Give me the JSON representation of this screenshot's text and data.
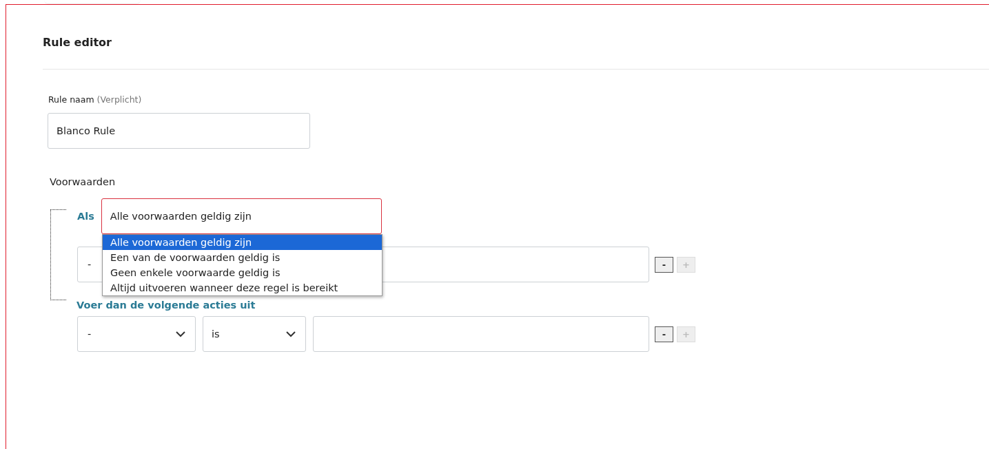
{
  "title": "Rule editor",
  "name_field": {
    "label": "Rule naam",
    "hint": "(Verplicht)",
    "value": "Blanco Rule"
  },
  "conditions": {
    "heading": "Voorwaarden",
    "if_label": "Als",
    "mode_select": {
      "value": "Alle voorwaarden geldig zijn",
      "expanded": true,
      "invalid": true,
      "options": [
        {
          "label": "Alle voorwaarden geldig zijn",
          "selected": true
        },
        {
          "label": "Een van de voorwaarden geldig is",
          "selected": false
        },
        {
          "label": "Geen enkele voorwaarde geldig is",
          "selected": false
        },
        {
          "label": "Altijd uitvoeren wanneer deze regel is bereikt",
          "selected": false
        }
      ]
    },
    "rows": [
      {
        "field": "-",
        "remove_label": "-",
        "add_label": "+",
        "remove_disabled": false,
        "add_disabled": true
      }
    ]
  },
  "actions": {
    "label": "Voer dan de volgende acties uit",
    "rows": [
      {
        "field": "-",
        "operator": "is",
        "remove_label": "-",
        "add_label": "+",
        "remove_disabled": false,
        "add_disabled": true
      }
    ]
  }
}
